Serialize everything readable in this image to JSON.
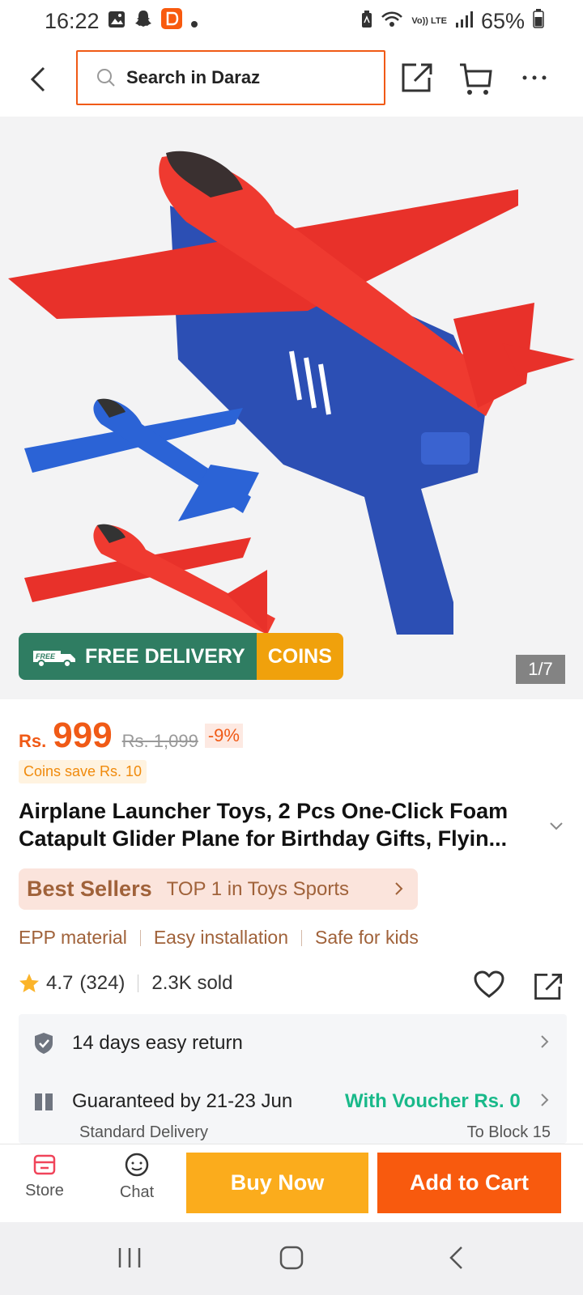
{
  "status": {
    "time": "16:22",
    "battery": "65%",
    "network_label": "Vo)) LTE"
  },
  "header": {
    "search_placeholder": "Search in Daraz",
    "icons": [
      "back-icon",
      "search-icon",
      "share-icon",
      "cart-icon",
      "more-icon"
    ]
  },
  "hero": {
    "image_counter": "1/7",
    "badge_free_tag": "FREE",
    "badge_delivery": "FREE DELIVERY",
    "badge_coins": "COINS"
  },
  "price": {
    "currency": "Rs.",
    "value": "999",
    "original": "Rs. 1,099",
    "discount": "-9%",
    "coins_save": "Coins save Rs. 10"
  },
  "product": {
    "title": "Airplane Launcher Toys, 2 Pcs One-Click Foam Catapult Glider Plane for Birthday Gifts, Flyin..."
  },
  "bestseller": {
    "label": "Best Sellers",
    "rank": "TOP 1 in Toys Sports"
  },
  "features": [
    "EPP material",
    "Easy installation",
    "Safe for kids"
  ],
  "rating": {
    "score": "4.7",
    "count": "(324)",
    "sold": "2.3K sold"
  },
  "info": {
    "return": "14 days easy return",
    "guarantee": "Guaranteed by 21-23 Jun",
    "voucher": "With Voucher Rs. 0",
    "delivery_type": "Standard Delivery",
    "location": "To Block 15"
  },
  "bottom": {
    "store": "Store",
    "chat": "Chat",
    "buy_now": "Buy Now",
    "add_to_cart": "Add to Cart"
  },
  "colors": {
    "accent": "#f05a16",
    "buy_now": "#fbac1c",
    "add_to_cart": "#f85a0e",
    "free_delivery": "#2f7d62",
    "coins": "#f0a10c",
    "voucher": "#19b98a"
  }
}
